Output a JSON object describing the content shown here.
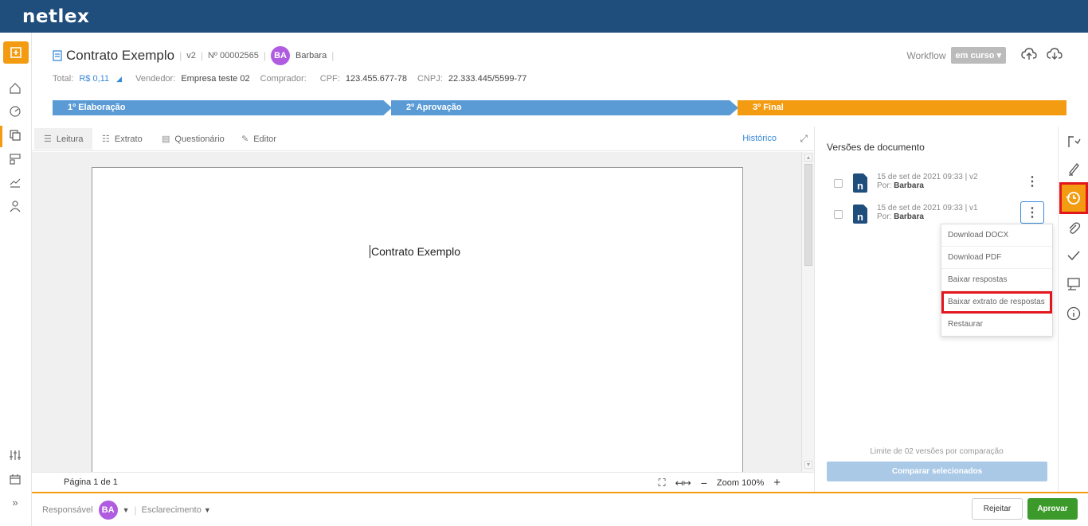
{
  "app": {
    "logo": "netlex"
  },
  "document": {
    "title": "Contrato Exemplo",
    "version": "v2",
    "number": "Nº 00002565",
    "owner_initials": "BA",
    "owner_name": "Barbara"
  },
  "meta": {
    "total_label": "Total:",
    "total_value": "R$ 0,11",
    "vendedor_label": "Vendedor:",
    "vendedor_value": "Empresa teste 02",
    "comprador_label": "Comprador:",
    "cpf_label": "CPF:",
    "cpf_value": "123.455.677-78",
    "cnpj_label": "CNPJ:",
    "cnpj_value": "22.333.445/5599-77"
  },
  "workflow": {
    "label": "Workflow",
    "status": "em curso"
  },
  "stages": [
    {
      "label": "1º Elaboração",
      "color": "#5b9bd5"
    },
    {
      "label": "2º Aprovação",
      "color": "#5b9bd5"
    },
    {
      "label": "3º Final",
      "color": "#f39c12"
    }
  ],
  "tabs": [
    {
      "label": "Leitura",
      "icon": "lines-icon"
    },
    {
      "label": "Extrato",
      "icon": "list-icon"
    },
    {
      "label": "Questionário",
      "icon": "form-icon"
    },
    {
      "label": "Editor",
      "icon": "edit-icon"
    }
  ],
  "historico_label": "Histórico",
  "page_content": {
    "text": "Contrato Exemplo"
  },
  "status": {
    "page_info": "Página 1 de 1",
    "zoom": "Zoom 100%"
  },
  "versions_panel": {
    "title": "Versões de documento",
    "versions": [
      {
        "date": "15 de set de 2021 09:33 | v2",
        "by_label": "Por:",
        "by": "Barbara"
      },
      {
        "date": "15 de set de 2021 09:33 | v1",
        "by_label": "Por:",
        "by": "Barbara"
      }
    ],
    "menu": [
      "Download DOCX",
      "Download PDF",
      "Baixar respostas",
      "Baixar extrato de respostas",
      "Restaurar"
    ],
    "limit_text": "Limite de 02 versões por comparação",
    "compare_label": "Comparar selecionados"
  },
  "footer": {
    "responsavel_label": "Responsável",
    "responsavel_initials": "BA",
    "esclarecimento_label": "Esclarecimento",
    "reject_label": "Rejeitar",
    "approve_label": "Aprovar"
  },
  "colors": {
    "brand": "#1f4e7c",
    "accent": "#f39c12",
    "approve": "#3c9a2b",
    "highlight": "#e3161e"
  }
}
